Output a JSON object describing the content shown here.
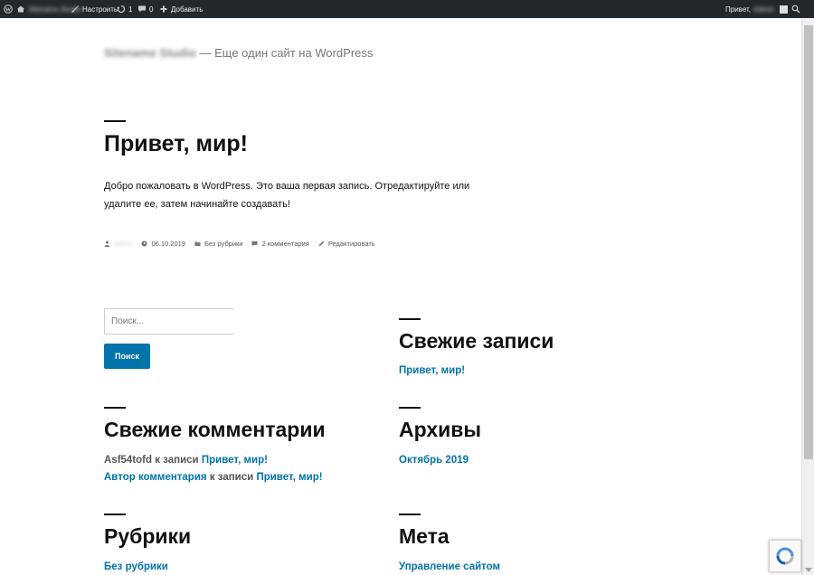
{
  "admin_bar": {
    "site_name": "Sitename Studio",
    "customize": "Настроить",
    "updates_count": "1",
    "comments_count": "0",
    "add_new": "Добавить",
    "greeting": "Привет,",
    "username": "Admin"
  },
  "site": {
    "title": "Sitename Studio",
    "separator": "—",
    "description": "Еще один сайт на WordPress"
  },
  "post": {
    "title": "Привет, мир!",
    "content": "Добро пожаловать в WordPress. Это ваша первая запись. Отредактируйте или удалите ее, затем начинайте создавать!",
    "meta": {
      "author": "admin",
      "date": "06.10.2019",
      "category": "Без рубрики",
      "comments": "2 комментария",
      "edit": "Редактировать"
    }
  },
  "search": {
    "placeholder": "Поиск...",
    "button": "Поиск"
  },
  "widgets": {
    "recent_posts": {
      "title": "Свежие записи",
      "items": [
        "Привет, мир!"
      ]
    },
    "recent_comments": {
      "title": "Свежие комментарии",
      "items": [
        {
          "author": "Asf54tofd",
          "connector": "к записи",
          "post": "Привет, мир!"
        },
        {
          "author": "Автор комментария",
          "connector": "к записи",
          "post": "Привет, мир!"
        }
      ]
    },
    "archives": {
      "title": "Архивы",
      "items": [
        "Октябрь 2019"
      ]
    },
    "categories": {
      "title": "Рубрики",
      "items": [
        "Без рубрики"
      ]
    },
    "meta": {
      "title": "Мета",
      "items": [
        "Управление сайтом"
      ]
    }
  },
  "colors": {
    "admin_bar_bg": "#23282d",
    "link": "#0073aa",
    "button": "#0073aa"
  }
}
